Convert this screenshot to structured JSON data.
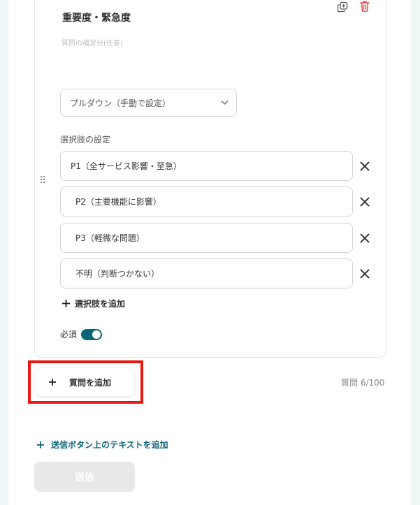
{
  "question": {
    "title": "重要度・緊急度",
    "subtitle_placeholder": "質問の補足分(任意)",
    "answer_type": "プルダウン（手動で設定）",
    "options_label": "選択肢の設定",
    "options": [
      {
        "label": "P1（全サービス影響・至急）"
      },
      {
        "label": "P2（主要機能に影響）"
      },
      {
        "label": "P3（軽微な問題）"
      },
      {
        "label": "不明（判断つかない）"
      }
    ],
    "add_option_label": "選択肢を追加",
    "required_label": "必須",
    "required_on": true
  },
  "footer": {
    "add_question_label": "質問を追加",
    "question_count": "質問 6/100",
    "add_submit_text_label": "送信ボタン上のテキストを追加",
    "submit_label": "送信"
  },
  "colors": {
    "accent": "#0b6478",
    "highlight": "#e8170f",
    "trash": "#e0434a"
  }
}
